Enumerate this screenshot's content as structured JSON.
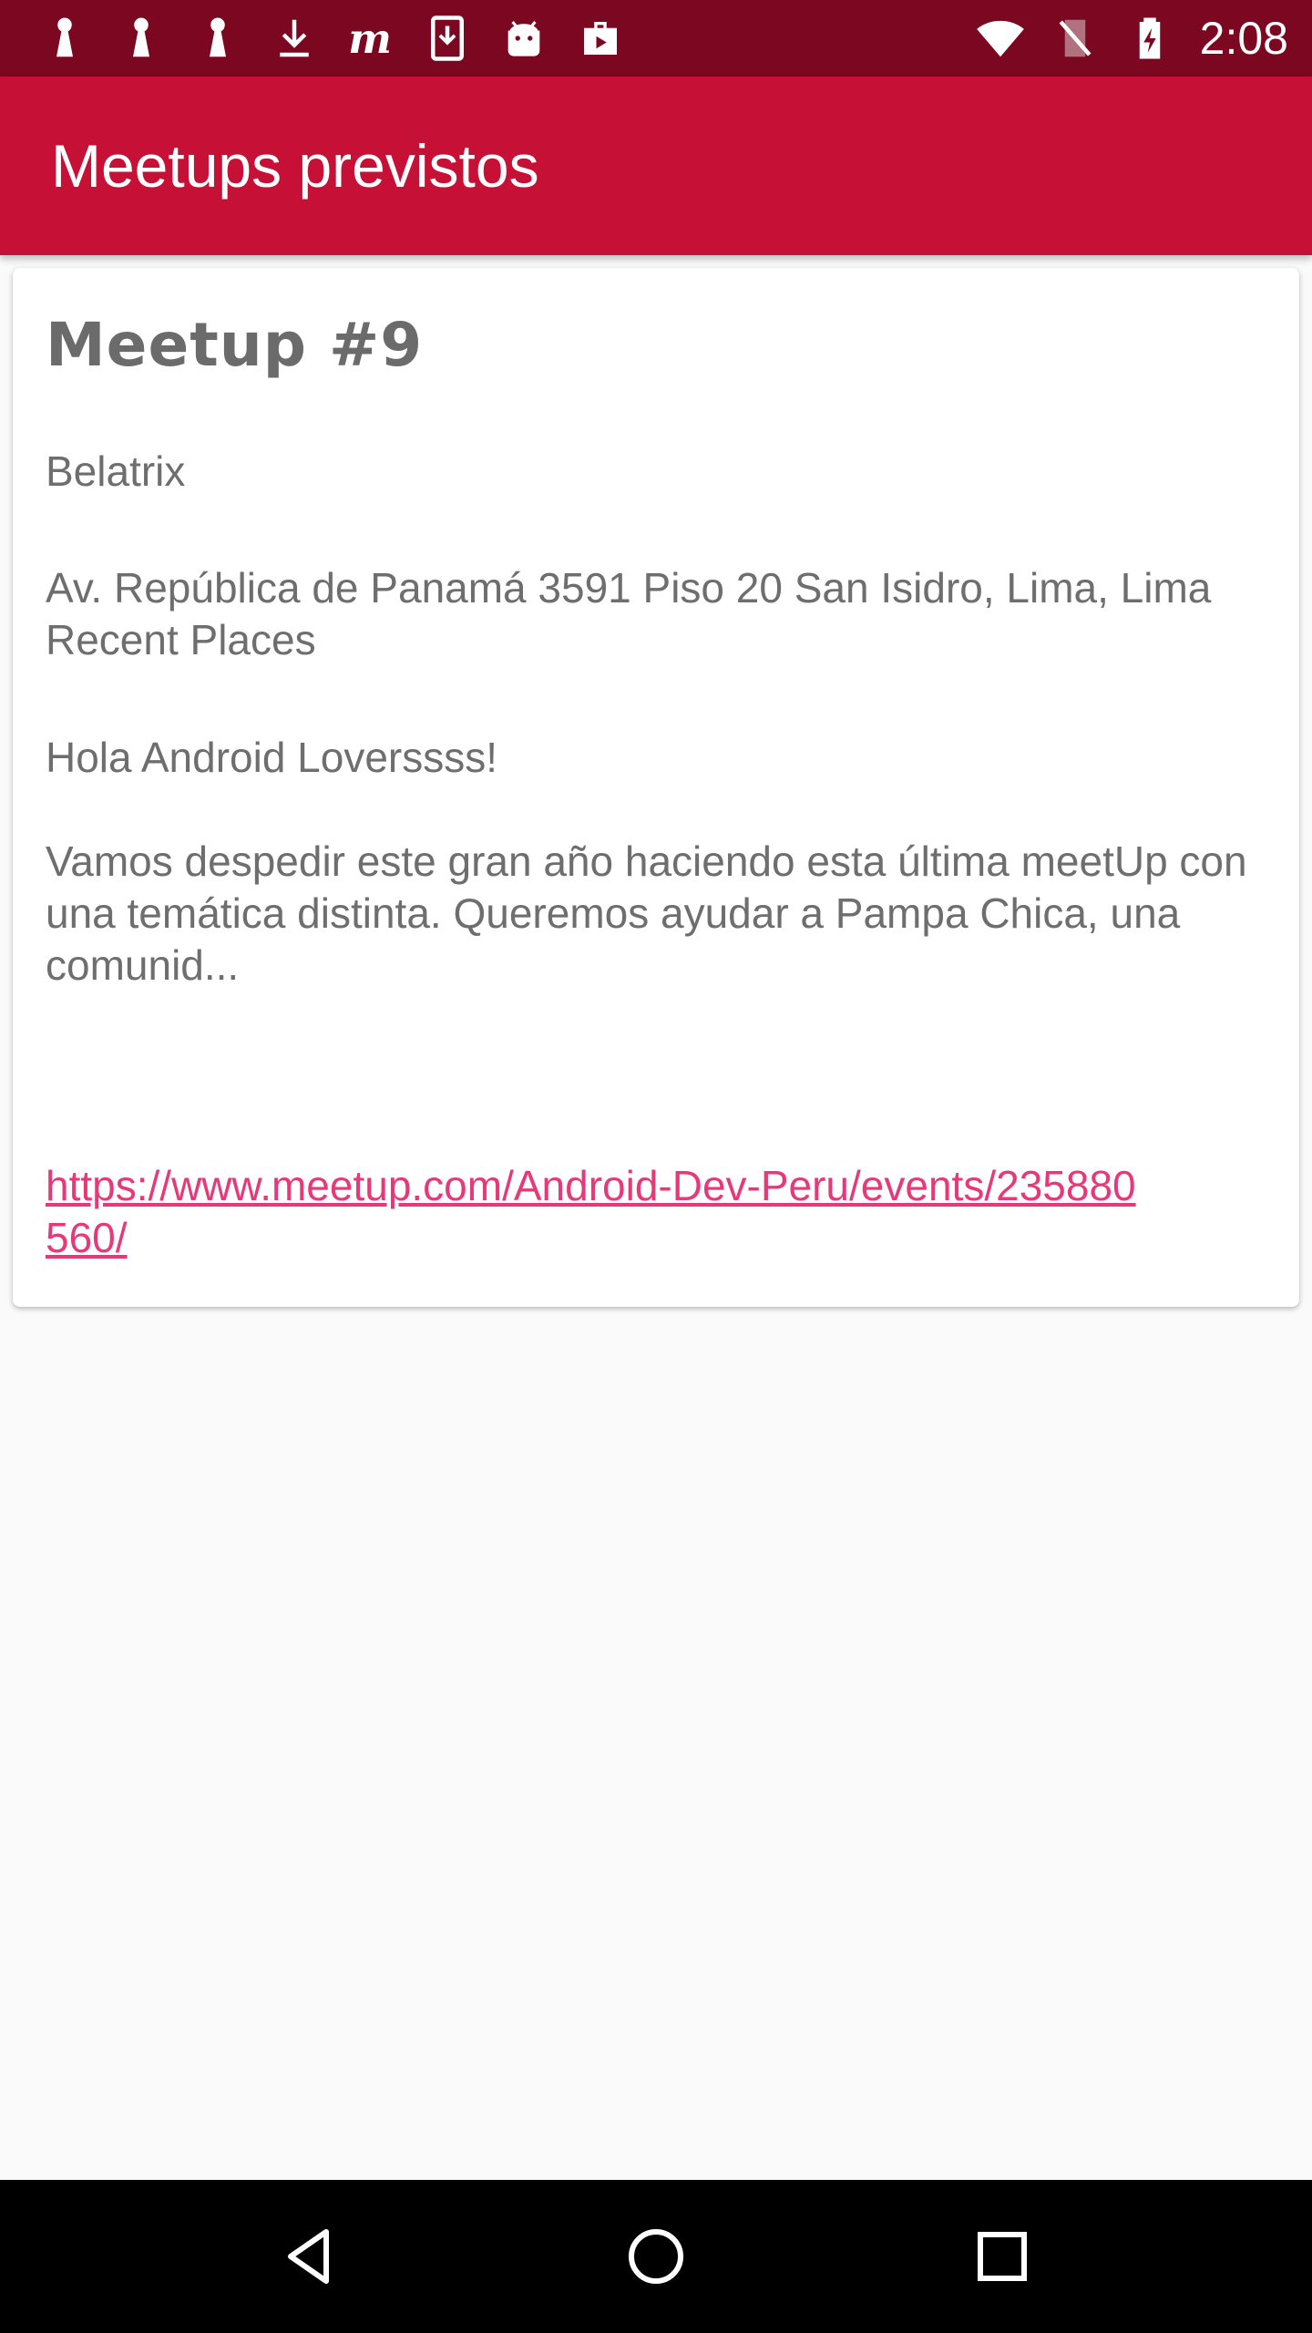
{
  "status_bar": {
    "time": "2:08",
    "left_icons": [
      "keyhole-icon",
      "keyhole-icon",
      "keyhole-icon",
      "download-icon",
      "meetup-icon",
      "file-download-icon",
      "android-icon",
      "briefcase-icon"
    ],
    "right_icons": [
      "wifi-icon",
      "no-signal-icon",
      "battery-charging-icon"
    ]
  },
  "app_bar": {
    "title": "Meetups previstos"
  },
  "meetup": {
    "title": "Meetup #9",
    "group": "Belatrix",
    "address_line1": "Av. República de Panamá 3591 Piso 20 San Isidro, Lima, Lima",
    "address_line2": "Recent Places",
    "greeting": "Hola Android Loverssss!",
    "description": "Vamos despedir este gran año haciendo esta última meetUp con una temática distinta. Queremos ayudar a Pampa Chica, una comunid...",
    "link": "https://www.meetup.com/Android-Dev-Peru/events/235880560/"
  },
  "nav_bar": {
    "buttons": [
      "back-icon",
      "home-icon",
      "recents-icon"
    ]
  },
  "colors": {
    "status_bar": "#7b0720",
    "app_bar": "#c71035",
    "link": "#e8387a",
    "background": "#fafafa"
  }
}
